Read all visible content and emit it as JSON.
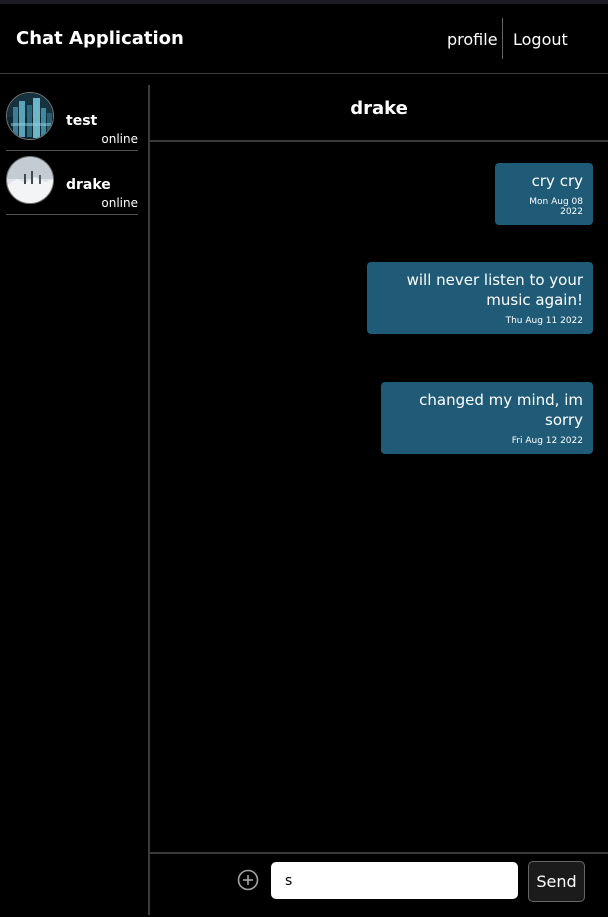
{
  "header": {
    "title": "Chat Application",
    "nav": {
      "profile_label": "profile",
      "logout_label": "Logout"
    }
  },
  "sidebar": {
    "contacts": [
      {
        "name": "test",
        "status": "online"
      },
      {
        "name": "drake",
        "status": "online"
      }
    ]
  },
  "chat": {
    "title": "drake",
    "messages": [
      {
        "text": "cry cry",
        "date": "Mon Aug 08 2022"
      },
      {
        "text": "will never listen to your music again!",
        "date": "Thu Aug 11 2022"
      },
      {
        "text": "changed my mind, im sorry",
        "date": "Fri Aug 12 2022"
      }
    ]
  },
  "composer": {
    "input_value": "s",
    "send_label": "Send",
    "add_icon": "plus-circle-icon"
  },
  "colors": {
    "background": "#000000",
    "message_bubble": "#1f5b77",
    "input_background": "#ffffff"
  }
}
